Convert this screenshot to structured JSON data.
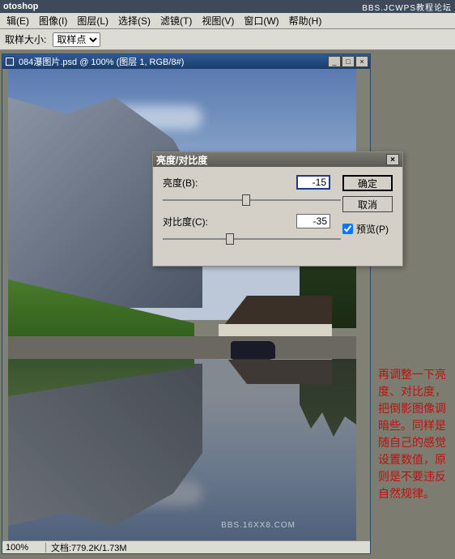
{
  "topbar": {
    "app_title": "otoshop",
    "watermark": "BBS.JCWPS教程论坛"
  },
  "menubar": {
    "items": [
      "辑(E)",
      "图像(I)",
      "图层(L)",
      "选择(S)",
      "滤镜(T)",
      "视图(V)",
      "窗口(W)",
      "帮助(H)"
    ]
  },
  "optionsbar": {
    "label": "取样大小:",
    "selected": "取样点"
  },
  "document": {
    "title": "084瀑图片.psd @ 100% (图层 1, RGB/8#)",
    "zoom": "100%",
    "docinfo": "文档:779.2K/1.73M"
  },
  "dialog": {
    "title": "亮度/对比度",
    "brightness_label": "亮度(B):",
    "brightness_value": "-15",
    "contrast_label": "对比度(C):",
    "contrast_value": "-35",
    "ok": "确定",
    "cancel": "取消",
    "preview": "预览(P)"
  },
  "annotation": {
    "text": "再调整一下亮度、对比度，把倒影图像调暗些。同样是随自己的感觉设置数值，原则是不要违反自然规律。"
  },
  "watermark_bottom": "BBS.16XX8.COM"
}
